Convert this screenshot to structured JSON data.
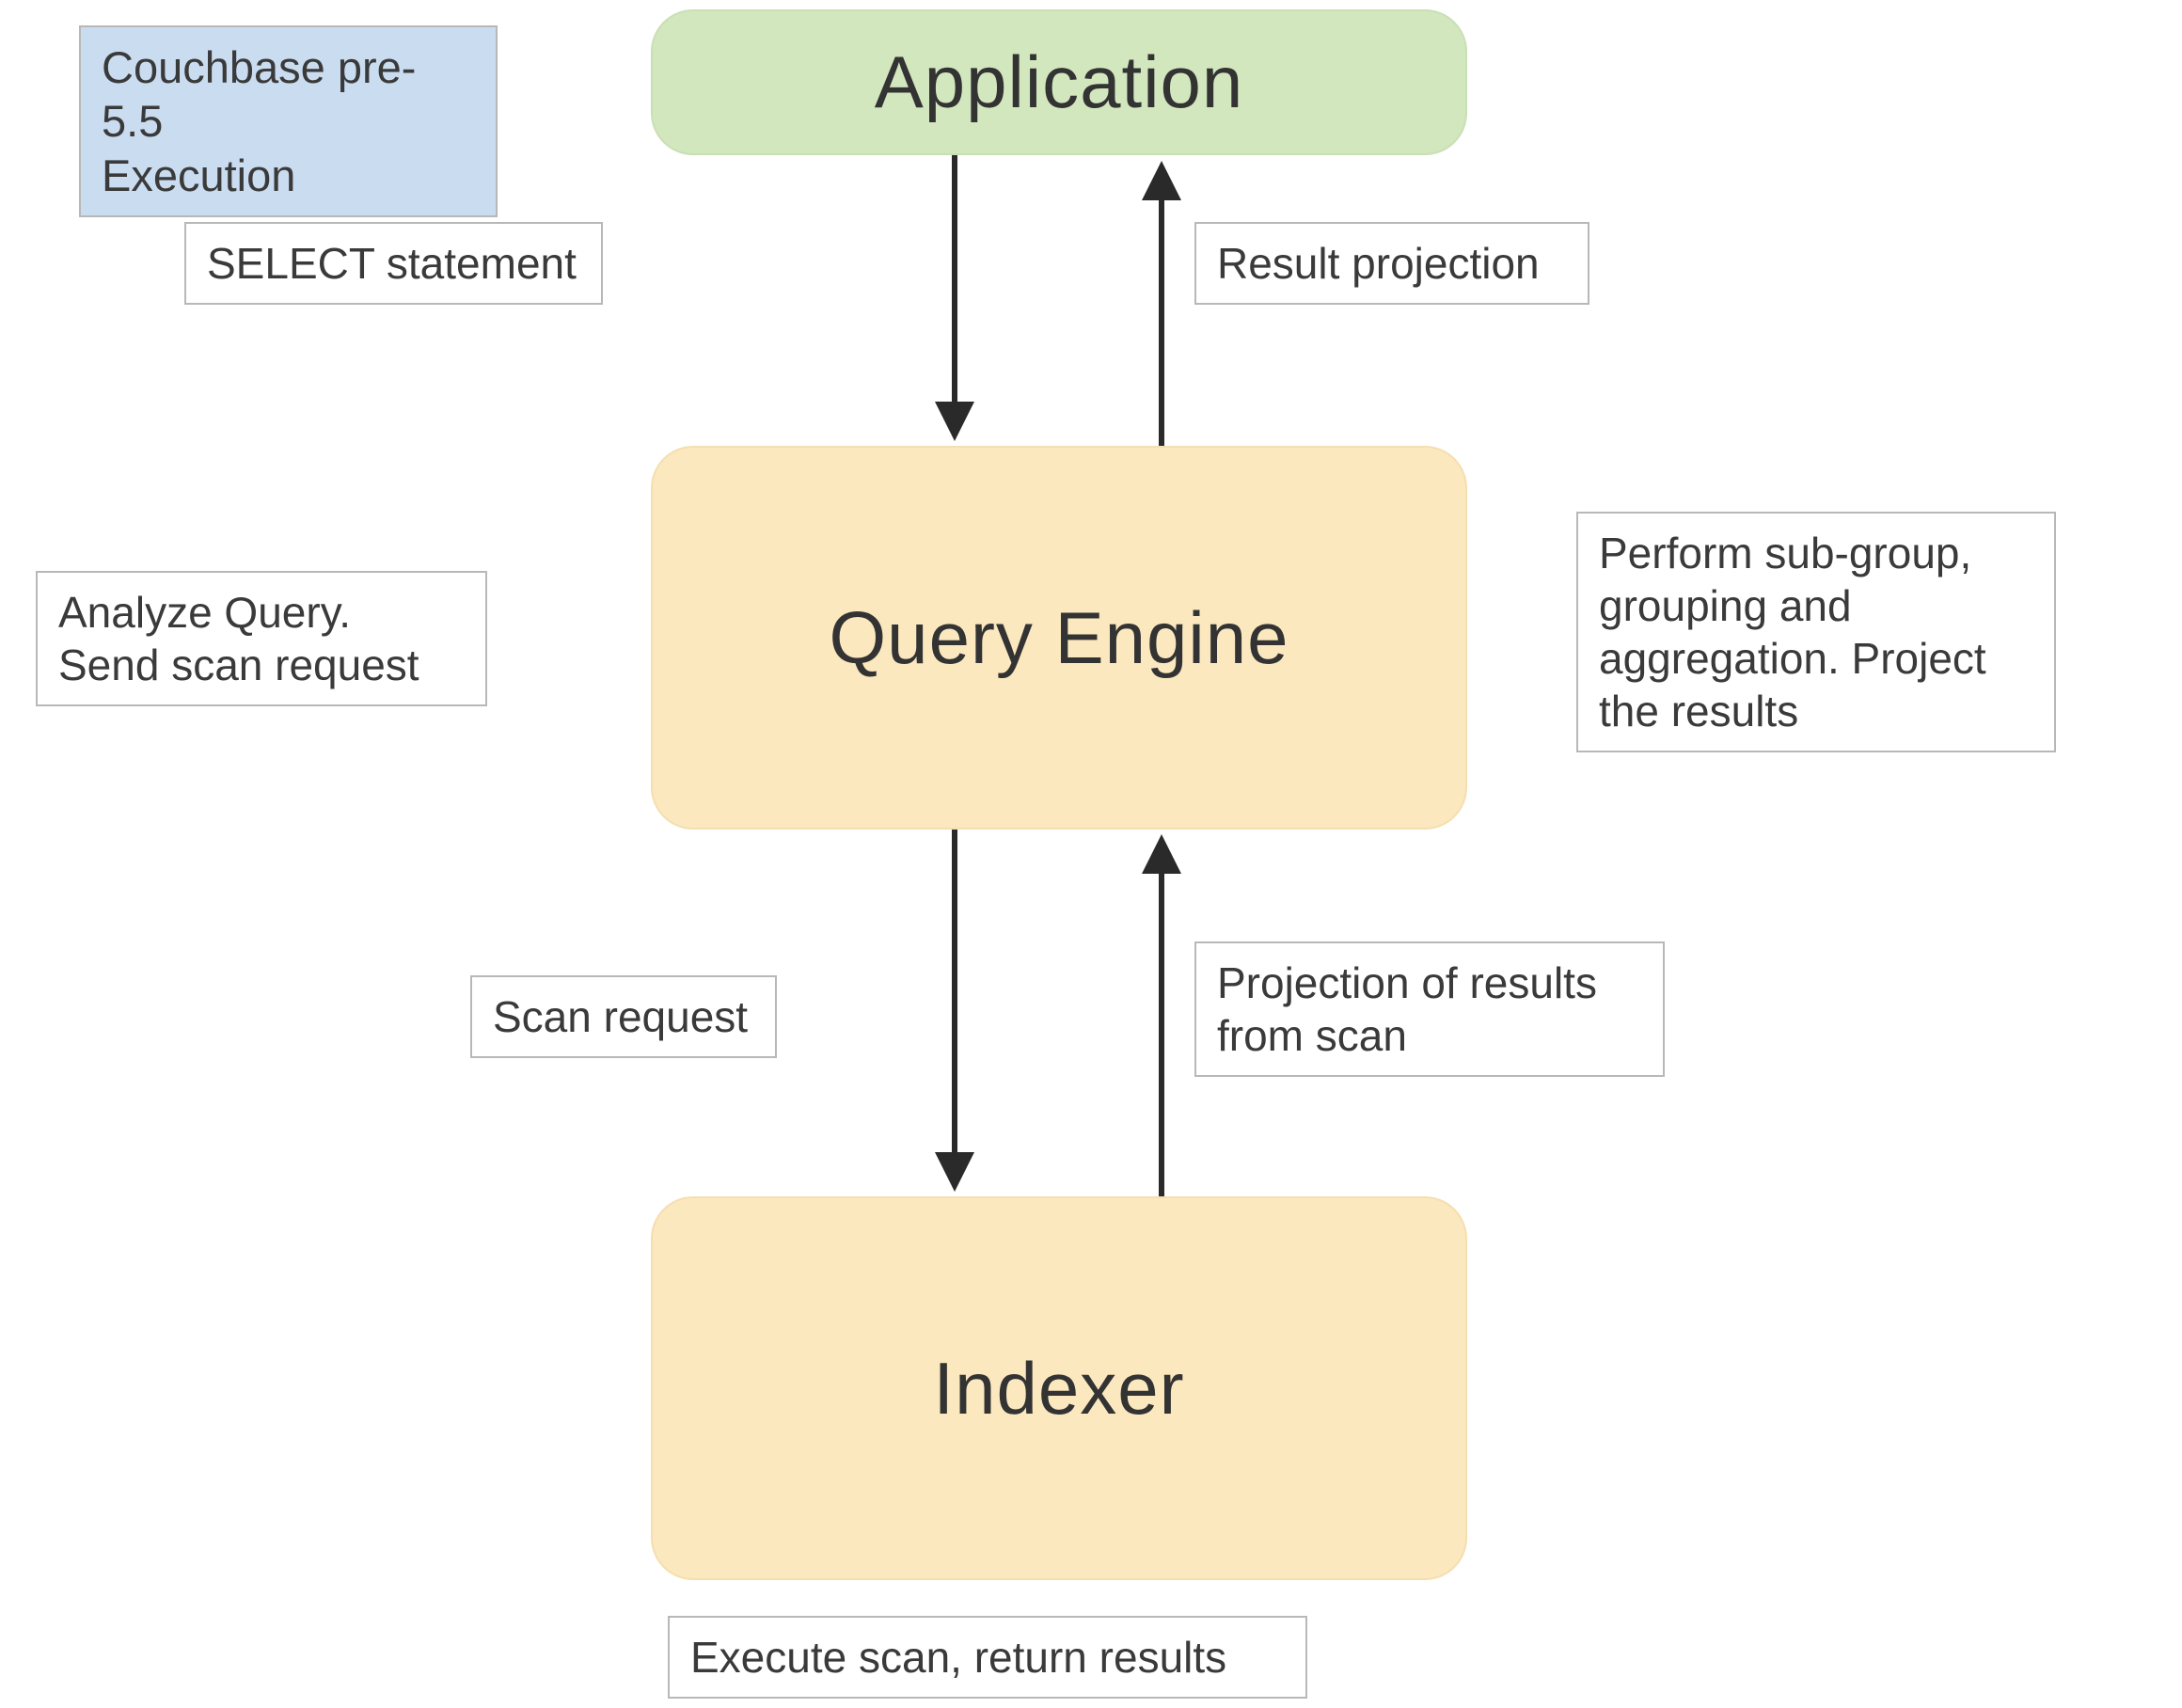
{
  "diagram": {
    "title_box": "Couchbase pre-5.5\nExecution",
    "nodes": {
      "application": "Application",
      "query_engine": "Query Engine",
      "indexer": "Indexer"
    },
    "edges": {
      "app_to_qe": "SELECT statement",
      "qe_to_app": "Result projection",
      "qe_left": "Analyze Query.\nSend scan request",
      "qe_right": "Perform sub-group,\ngrouping and\naggregation. Project\nthe results",
      "qe_to_idx": "Scan request",
      "idx_to_qe": "Projection of results\nfrom scan",
      "idx_bottom": "Execute scan, return results"
    }
  }
}
